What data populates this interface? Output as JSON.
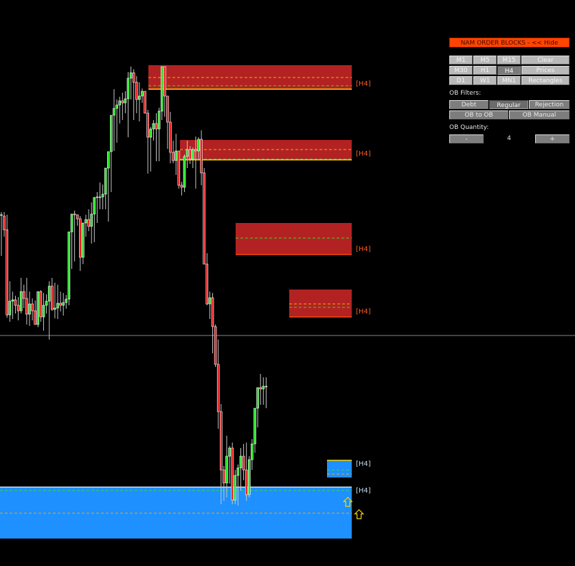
{
  "panel": {
    "title_button": "NAM ORDER BLOCKS - << Hide",
    "timeframes": [
      {
        "label": "M1",
        "selected": false
      },
      {
        "label": "M5",
        "selected": false
      },
      {
        "label": "M15",
        "selected": false
      },
      {
        "label": "M30",
        "selected": false
      },
      {
        "label": "H1",
        "selected": false
      },
      {
        "label": "H4",
        "selected": true
      },
      {
        "label": "D1",
        "selected": false
      },
      {
        "label": "W1",
        "selected": false
      },
      {
        "label": "MN1",
        "selected": false
      }
    ],
    "actions": [
      "Clear",
      "Prices",
      "Rectangles"
    ],
    "filters_label": "OB Filters:",
    "filters": [
      {
        "label": "Debt",
        "selected": false
      },
      {
        "label": "Regular",
        "selected": true
      },
      {
        "label": "Rejection",
        "selected": false
      }
    ],
    "modes": [
      "OB to OB",
      "OB Manual"
    ],
    "quantity_label": "OB Quantity:",
    "quantity_minus": "-",
    "quantity_value": "4",
    "quantity_plus": "+"
  },
  "colors": {
    "background": "#000000",
    "bull_body": "#1ee61e",
    "bear_body": "#e61e1e",
    "candle_outline": "#ffffff",
    "wick": "#c8c8c8",
    "supply_zone": "#b22222",
    "demand_zone": "#1e90ff",
    "supply_label": "#ff5a1e",
    "demand_label": "#c8dcf0",
    "mid_line": "#ffa500",
    "edge_line": "#32dc32",
    "price_line": "#7a8a9a",
    "arrow": "#ffd700"
  },
  "chart_data": {
    "type": "candlestick",
    "price_scale": "abstract units (higher = higher price)",
    "ylim": [
      0,
      825
    ],
    "current_price": 336,
    "candles": [
      [
        512,
        516,
        452,
        512
      ],
      [
        510,
        516,
        480,
        490
      ],
      [
        490,
        512,
        362,
        366
      ],
      [
        366,
        415,
        356,
        386
      ],
      [
        386,
        400,
        360,
        388
      ],
      [
        388,
        394,
        368,
        380
      ],
      [
        380,
        392,
        358,
        372
      ],
      [
        372,
        420,
        368,
        400
      ],
      [
        400,
        410,
        376,
        390
      ],
      [
        390,
        420,
        352,
        367
      ],
      [
        367,
        400,
        350,
        382
      ],
      [
        382,
        390,
        358,
        372
      ],
      [
        372,
        387,
        352,
        352
      ],
      [
        352,
        400,
        348,
        400
      ],
      [
        400,
        402,
        356,
        363
      ],
      [
        363,
        398,
        343,
        380
      ],
      [
        380,
        396,
        368,
        386
      ],
      [
        386,
        415,
        330,
        408
      ],
      [
        408,
        420,
        372,
        374
      ],
      [
        374,
        413,
        361,
        376
      ],
      [
        376,
        410,
        360,
        383
      ],
      [
        383,
        400,
        371,
        380
      ],
      [
        380,
        398,
        365,
        384
      ],
      [
        384,
        395,
        375,
        389
      ],
      [
        389,
        436,
        380,
        487
      ],
      [
        487,
        512,
        433,
        513
      ],
      [
        513,
        518,
        444,
        512
      ],
      [
        512,
        512,
        496,
        506
      ],
      [
        506,
        510,
        430,
        450
      ],
      [
        450,
        488,
        440,
        500
      ],
      [
        500,
        512,
        480,
        505
      ],
      [
        505,
        520,
        488,
        495
      ],
      [
        495,
        530,
        470,
        513
      ],
      [
        513,
        538,
        472,
        537
      ],
      [
        537,
        545,
        500,
        538
      ],
      [
        538,
        559,
        520,
        538
      ],
      [
        538,
        556,
        520,
        542
      ],
      [
        542,
        580,
        520,
        580
      ],
      [
        580,
        602,
        502,
        604
      ],
      [
        604,
        650,
        545,
        657
      ],
      [
        657,
        695,
        605,
        667
      ],
      [
        667,
        680,
        617,
        672
      ],
      [
        672,
        684,
        645,
        678
      ],
      [
        678,
        690,
        650,
        675
      ],
      [
        675,
        692,
        660,
        681
      ],
      [
        681,
        720,
        625,
        711
      ],
      [
        711,
        728,
        680,
        719
      ],
      [
        719,
        724,
        650,
        705
      ],
      [
        705,
        714,
        660,
        680
      ],
      [
        680,
        705,
        648,
        685
      ],
      [
        685,
        696,
        675,
        692
      ],
      [
        692,
        690,
        660,
        660
      ],
      [
        660,
        665,
        572,
        625
      ],
      [
        625,
        640,
        575,
        637
      ],
      [
        637,
        650,
        620,
        645
      ],
      [
        645,
        660,
        590,
        637
      ],
      [
        637,
        668,
        590,
        663
      ],
      [
        663,
        710,
        650,
        728
      ],
      [
        728,
        728,
        655,
        685
      ],
      [
        685,
        683,
        608,
        647
      ],
      [
        647,
        662,
        587,
        603
      ],
      [
        603,
        620,
        587,
        591
      ],
      [
        591,
        630,
        570,
        605
      ],
      [
        605,
        602,
        550,
        555
      ],
      [
        555,
        560,
        540,
        552
      ],
      [
        552,
        600,
        545,
        597
      ],
      [
        597,
        620,
        580,
        607
      ],
      [
        607,
        612,
        586,
        593
      ],
      [
        593,
        610,
        580,
        607
      ],
      [
        607,
        626,
        550,
        605
      ],
      [
        605,
        625,
        592,
        622
      ],
      [
        622,
        635,
        555,
        573
      ],
      [
        573,
        580,
        440,
        440
      ],
      [
        440,
        456,
        380,
        382
      ],
      [
        382,
        400,
        360,
        391
      ],
      [
        391,
        398,
        310,
        349
      ],
      [
        349,
        352,
        290,
        294
      ],
      [
        294,
        330,
        200,
        225
      ],
      [
        225,
        236,
        90,
        140
      ],
      [
        140,
        146,
        95,
        121
      ],
      [
        121,
        190,
        100,
        160
      ],
      [
        160,
        175,
        120,
        172
      ],
      [
        172,
        180,
        90,
        96
      ],
      [
        96,
        140,
        90,
        132
      ],
      [
        132,
        148,
        88,
        143
      ],
      [
        143,
        172,
        110,
        160
      ],
      [
        160,
        178,
        125,
        140
      ],
      [
        140,
        180,
        95,
        104
      ],
      [
        104,
        160,
        100,
        155
      ],
      [
        155,
        185,
        140,
        178
      ],
      [
        178,
        205,
        165,
        230
      ],
      [
        230,
        248,
        202,
        260
      ],
      [
        260,
        280,
        235,
        258
      ],
      [
        258,
        275,
        235,
        262
      ],
      [
        262,
        275,
        230,
        262
      ]
    ]
  },
  "zones": [
    {
      "kind": "supply",
      "timeframe_label": "[H4]",
      "top": 730,
      "bottom": 695,
      "mid": 712,
      "edge": 700
    },
    {
      "kind": "supply",
      "timeframe_label": "[H4]",
      "top": 621,
      "bottom": 592,
      "mid": 607,
      "edge": 593
    },
    {
      "kind": "supply",
      "timeframe_label": "[H4]",
      "top": 500,
      "bottom": 454,
      "mid": 478,
      "edge": 478
    },
    {
      "kind": "supply",
      "timeframe_label": "[H4]",
      "top": 403,
      "bottom": 363,
      "mid": 382,
      "edge": 377
    },
    {
      "kind": "demand",
      "timeframe_label": "[H4]",
      "top": 154,
      "bottom": 129,
      "mid": 134,
      "edge": 140
    },
    {
      "kind": "demand",
      "timeframe_label": "[H4]",
      "top": 115,
      "bottom": 40,
      "mid": 77,
      "edge": 110
    }
  ],
  "signals": [
    {
      "type": "buy-arrow",
      "candle_index": 123,
      "price": 100
    },
    {
      "type": "buy-arrow",
      "candle_index": 127,
      "price": 82
    }
  ]
}
